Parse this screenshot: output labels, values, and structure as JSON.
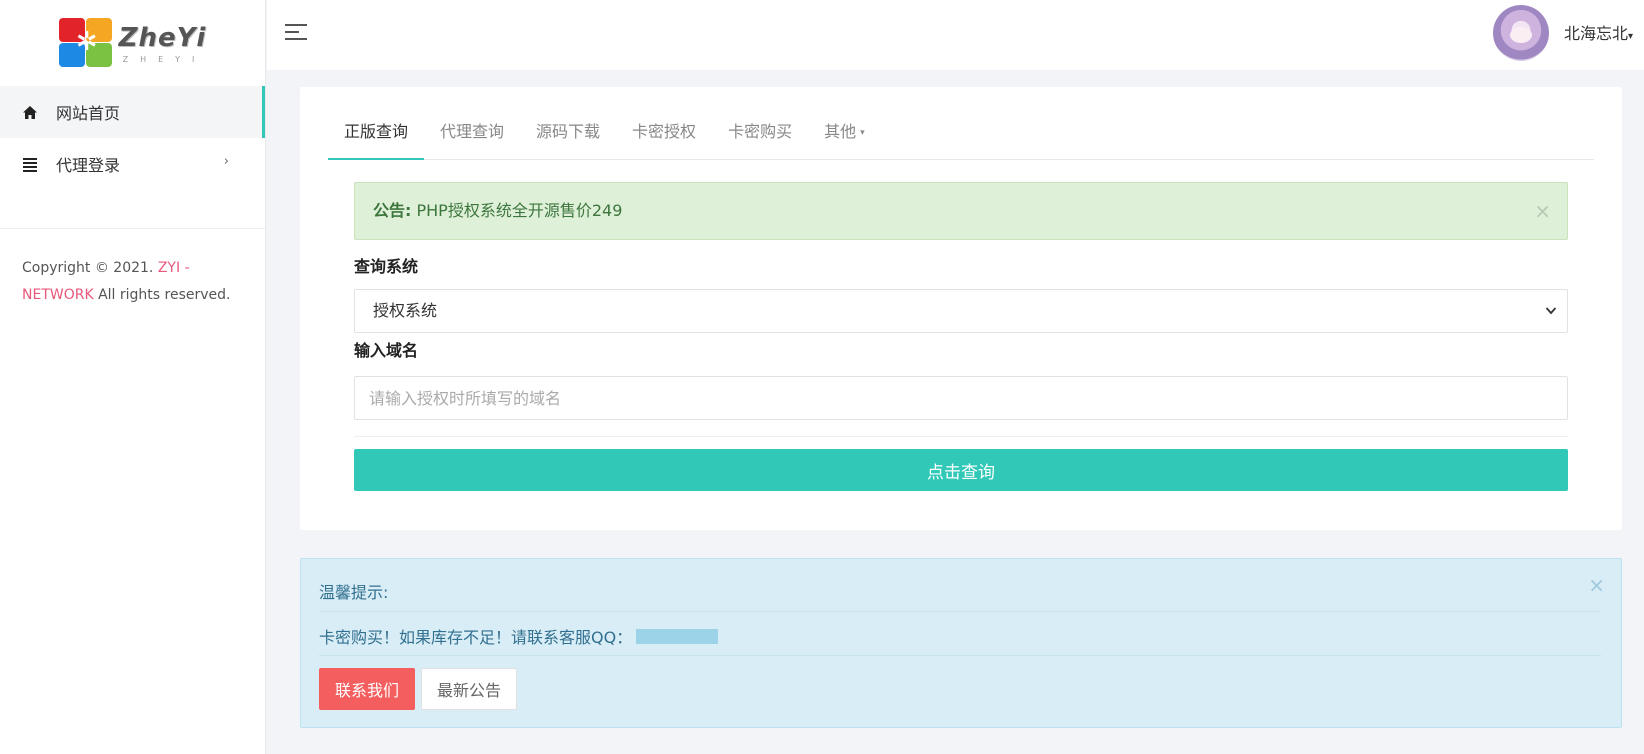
{
  "logo": {
    "word": "ZheYi",
    "sub": "ZHEYI"
  },
  "sidebar": {
    "items": [
      {
        "label": "网站首页",
        "icon": "home-icon"
      },
      {
        "label": "代理登录",
        "icon": "list-icon",
        "chevron": "›"
      }
    ],
    "copyright": {
      "prefix": "Copyright © 2021.",
      "brand": "ZYI - NETWORK",
      "suffix": "All rights reserved."
    }
  },
  "header": {
    "username": "北海忘北",
    "caret": "▾"
  },
  "tabs": [
    {
      "label": "正版查询"
    },
    {
      "label": "代理查询"
    },
    {
      "label": "源码下载"
    },
    {
      "label": "卡密授权"
    },
    {
      "label": "卡密购买"
    },
    {
      "label": "其他",
      "caret": "▾"
    }
  ],
  "notice": {
    "label": "公告:",
    "text": "PHP授权系统全开源售价249",
    "close": "×"
  },
  "form": {
    "system_label": "查询系统",
    "system_value": "授权系统",
    "domain_label": "输入域名",
    "domain_placeholder": "请输入授权时所填写的域名",
    "domain_value": "",
    "submit_label": "点击查询"
  },
  "info": {
    "title": "温馨提示:",
    "message": "卡密购买！如果库存不足！请联系客服QQ：",
    "contact_label": "联系我们",
    "news_label": "最新公告",
    "close": "×"
  },
  "colors": {
    "accent": "#32c8b8",
    "danger": "#f45e5e",
    "brand_pink": "#e8577a",
    "success_bg": "#dff0d8",
    "info_bg": "#d9edf7"
  }
}
